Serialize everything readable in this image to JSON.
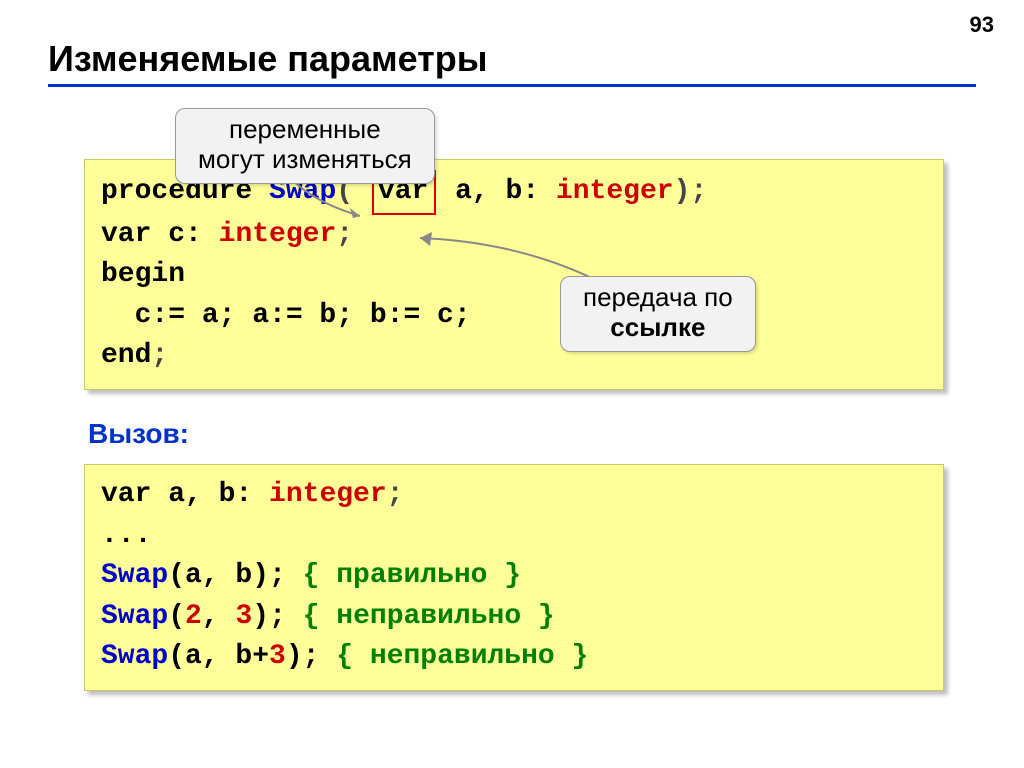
{
  "page_number": "93",
  "title": "Изменяемые параметры",
  "callouts": {
    "top_line1": "переменные",
    "top_line2": "могут изменяться",
    "right_line1": "передача по",
    "right_line2": "ссылке"
  },
  "code1": {
    "l1_procedure": "procedure",
    "l1_swap": "Swap",
    "l1_lparen": "(",
    "l1_var": "var",
    "l1_ab": " a, b: ",
    "l1_integer": "integer",
    "l1_rparen": ");",
    "l2_var": "var",
    "l2_c": " c: ",
    "l2_integer": "integer",
    "l2_semi": ";",
    "l3_begin": "begin",
    "l4_body": "  c:= a; a:= b; b:= c;",
    "l5_end": "end",
    "l5_semi": ";"
  },
  "call_label": "Вызов:",
  "code2": {
    "l1_var": "var",
    "l1_ab": " a, b: ",
    "l1_integer": "integer",
    "l1_semi": ";",
    "l2_dots": "...",
    "l3_swap": "Swap",
    "l3_args": "(a, b); ",
    "l3_comment": "{ правильно }",
    "l4_swap": "Swap",
    "l4_lp": "(",
    "l4_two": "2",
    "l4_comma": ", ",
    "l4_three": "3",
    "l4_rp": "); ",
    "l4_comment": "{ неправильно }",
    "l5_swap": "Swap",
    "l5_args": "(a, b+",
    "l5_three": "3",
    "l5_rp": "); ",
    "l5_comment": "{ неправильно }"
  }
}
